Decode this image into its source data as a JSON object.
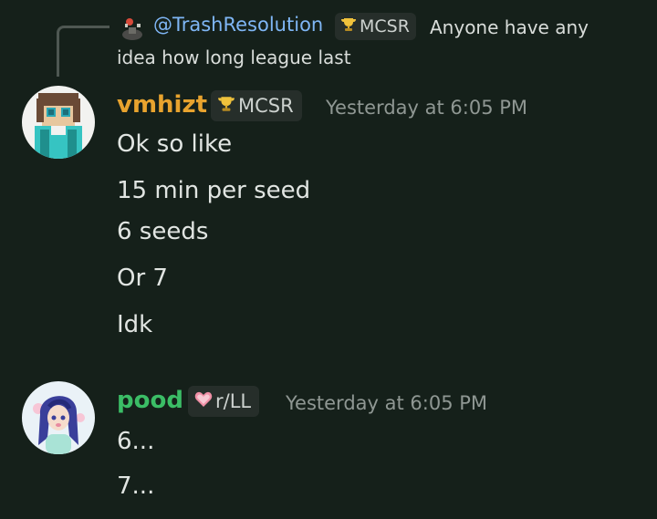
{
  "reply": {
    "username": "@TrashResolution",
    "tag": "MCSR",
    "text": "Anyone have any idea how long league last"
  },
  "messages": [
    {
      "username": "vmhizt",
      "tag": "MCSR",
      "timestamp": "Yesterday at 6:05 PM",
      "lines": [
        "Ok so like",
        "15 min per seed",
        "6 seeds",
        "Or 7",
        "Idk"
      ]
    },
    {
      "username": "pood",
      "tag": "r/LL",
      "timestamp": "Yesterday at 6:05 PM",
      "lines": [
        "6...",
        "7..."
      ]
    }
  ],
  "colors": {
    "background": "#15201a",
    "username_1": "#e8a32e",
    "username_2": "#3bbd66",
    "mention": "#7fb6f5"
  },
  "icons": [
    "trophy-icon",
    "heart-icon",
    "reply-spine"
  ]
}
